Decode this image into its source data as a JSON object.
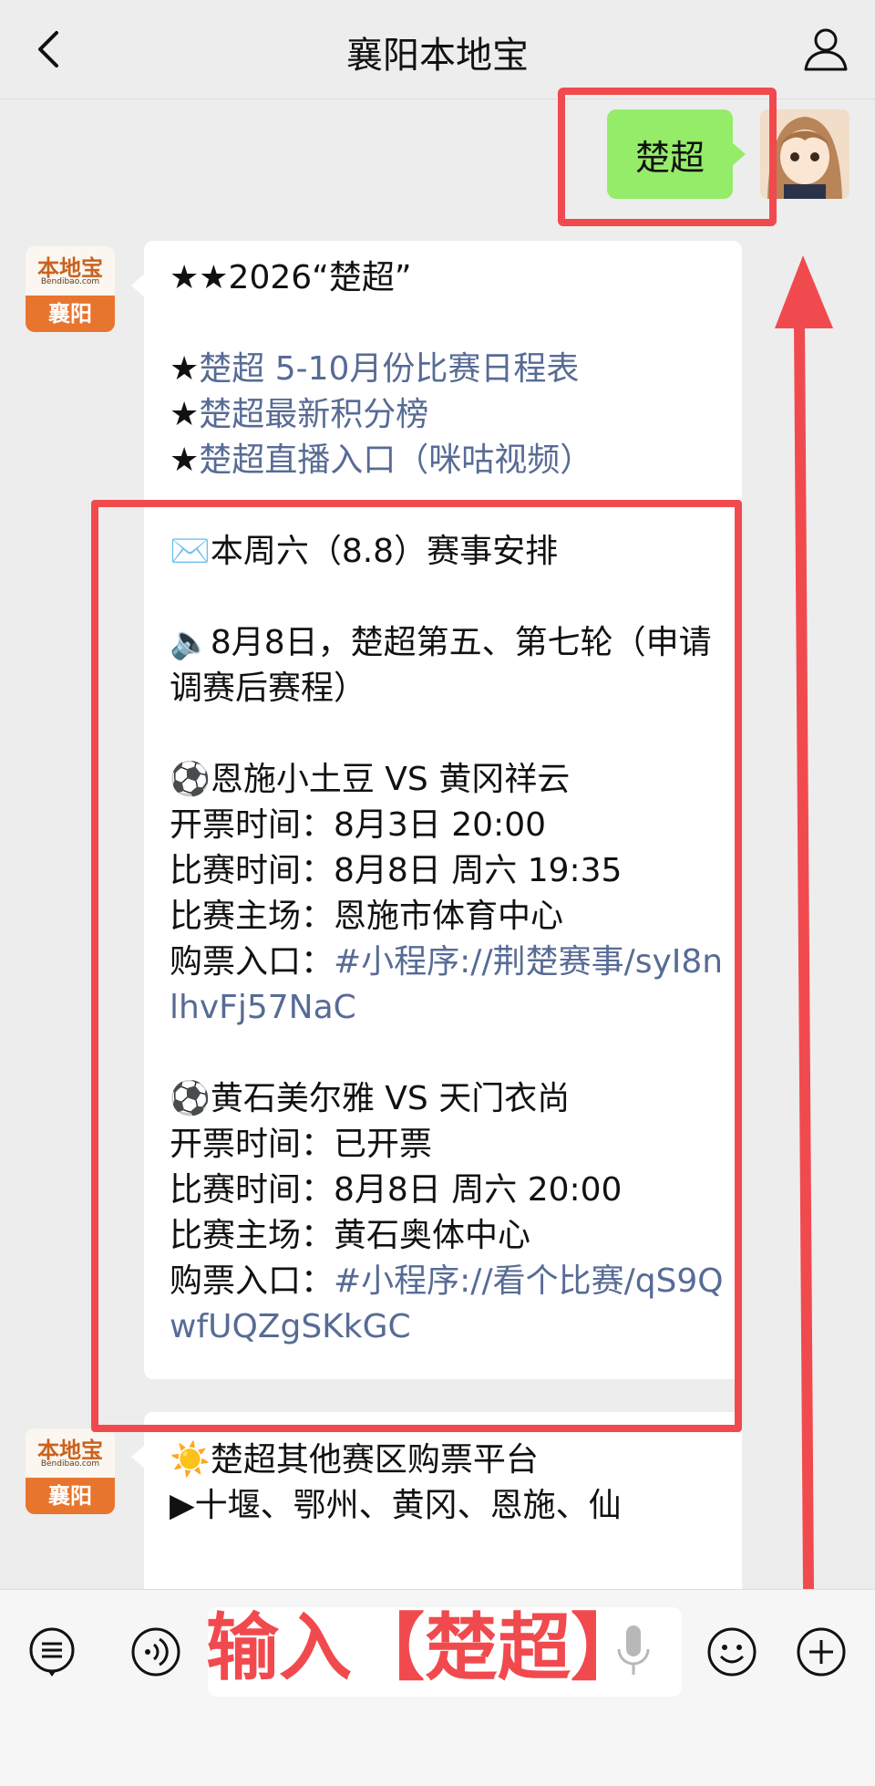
{
  "header": {
    "title": "襄阳本地宝"
  },
  "user_message": {
    "text": "楚超"
  },
  "bot_brand": {
    "name": "本地宝",
    "url": "Bendibao.com",
    "city": "襄阳"
  },
  "message1": {
    "headline": "★★2026“楚超”",
    "links": [
      {
        "star": "★",
        "text": "楚超 5-10月份比赛日程表"
      },
      {
        "star": "★",
        "text": "楚超最新积分榜"
      },
      {
        "star": "★",
        "text": "楚超直播入口（咪咕视频）"
      }
    ],
    "week_title": "✉️本周六（8.8）赛事安排",
    "round_info": "🔈8月8日，楚超第五、第七轮（申请调赛后赛程）",
    "match1": {
      "teams": "⚽恩施小土豆 VS 黄冈祥云",
      "ticket_time": "开票时间：8月3日 20:00",
      "match_time": "比赛时间：8月8日 周六 19:35",
      "venue": "比赛主场：恩施市体育中心",
      "buy_label": "购票入口：",
      "buy_link": "#小程序://荆楚赛事/syI8nlhvFj57NaC"
    },
    "match2": {
      "teams": "⚽黄石美尔雅 VS 天门衣尚",
      "ticket_time": "开票时间：已开票",
      "match_time": "比赛时间：8月8日 周六 20:00",
      "venue": "比赛主场：黄石奥体中心",
      "buy_label": "购票入口：",
      "buy_link": "#小程序://看个比赛/qS9QwfUQZgSKkGC"
    }
  },
  "message2": {
    "title": "☀️楚超其他赛区购票平台",
    "line": "▶十堰、鄂州、黄冈、恩施、仙"
  },
  "input": {
    "overlay_text": "输入【楚超】"
  },
  "colors": {
    "accent_red": "#f14a4e",
    "link": "#576b95",
    "self_bubble": "#95ec69"
  }
}
